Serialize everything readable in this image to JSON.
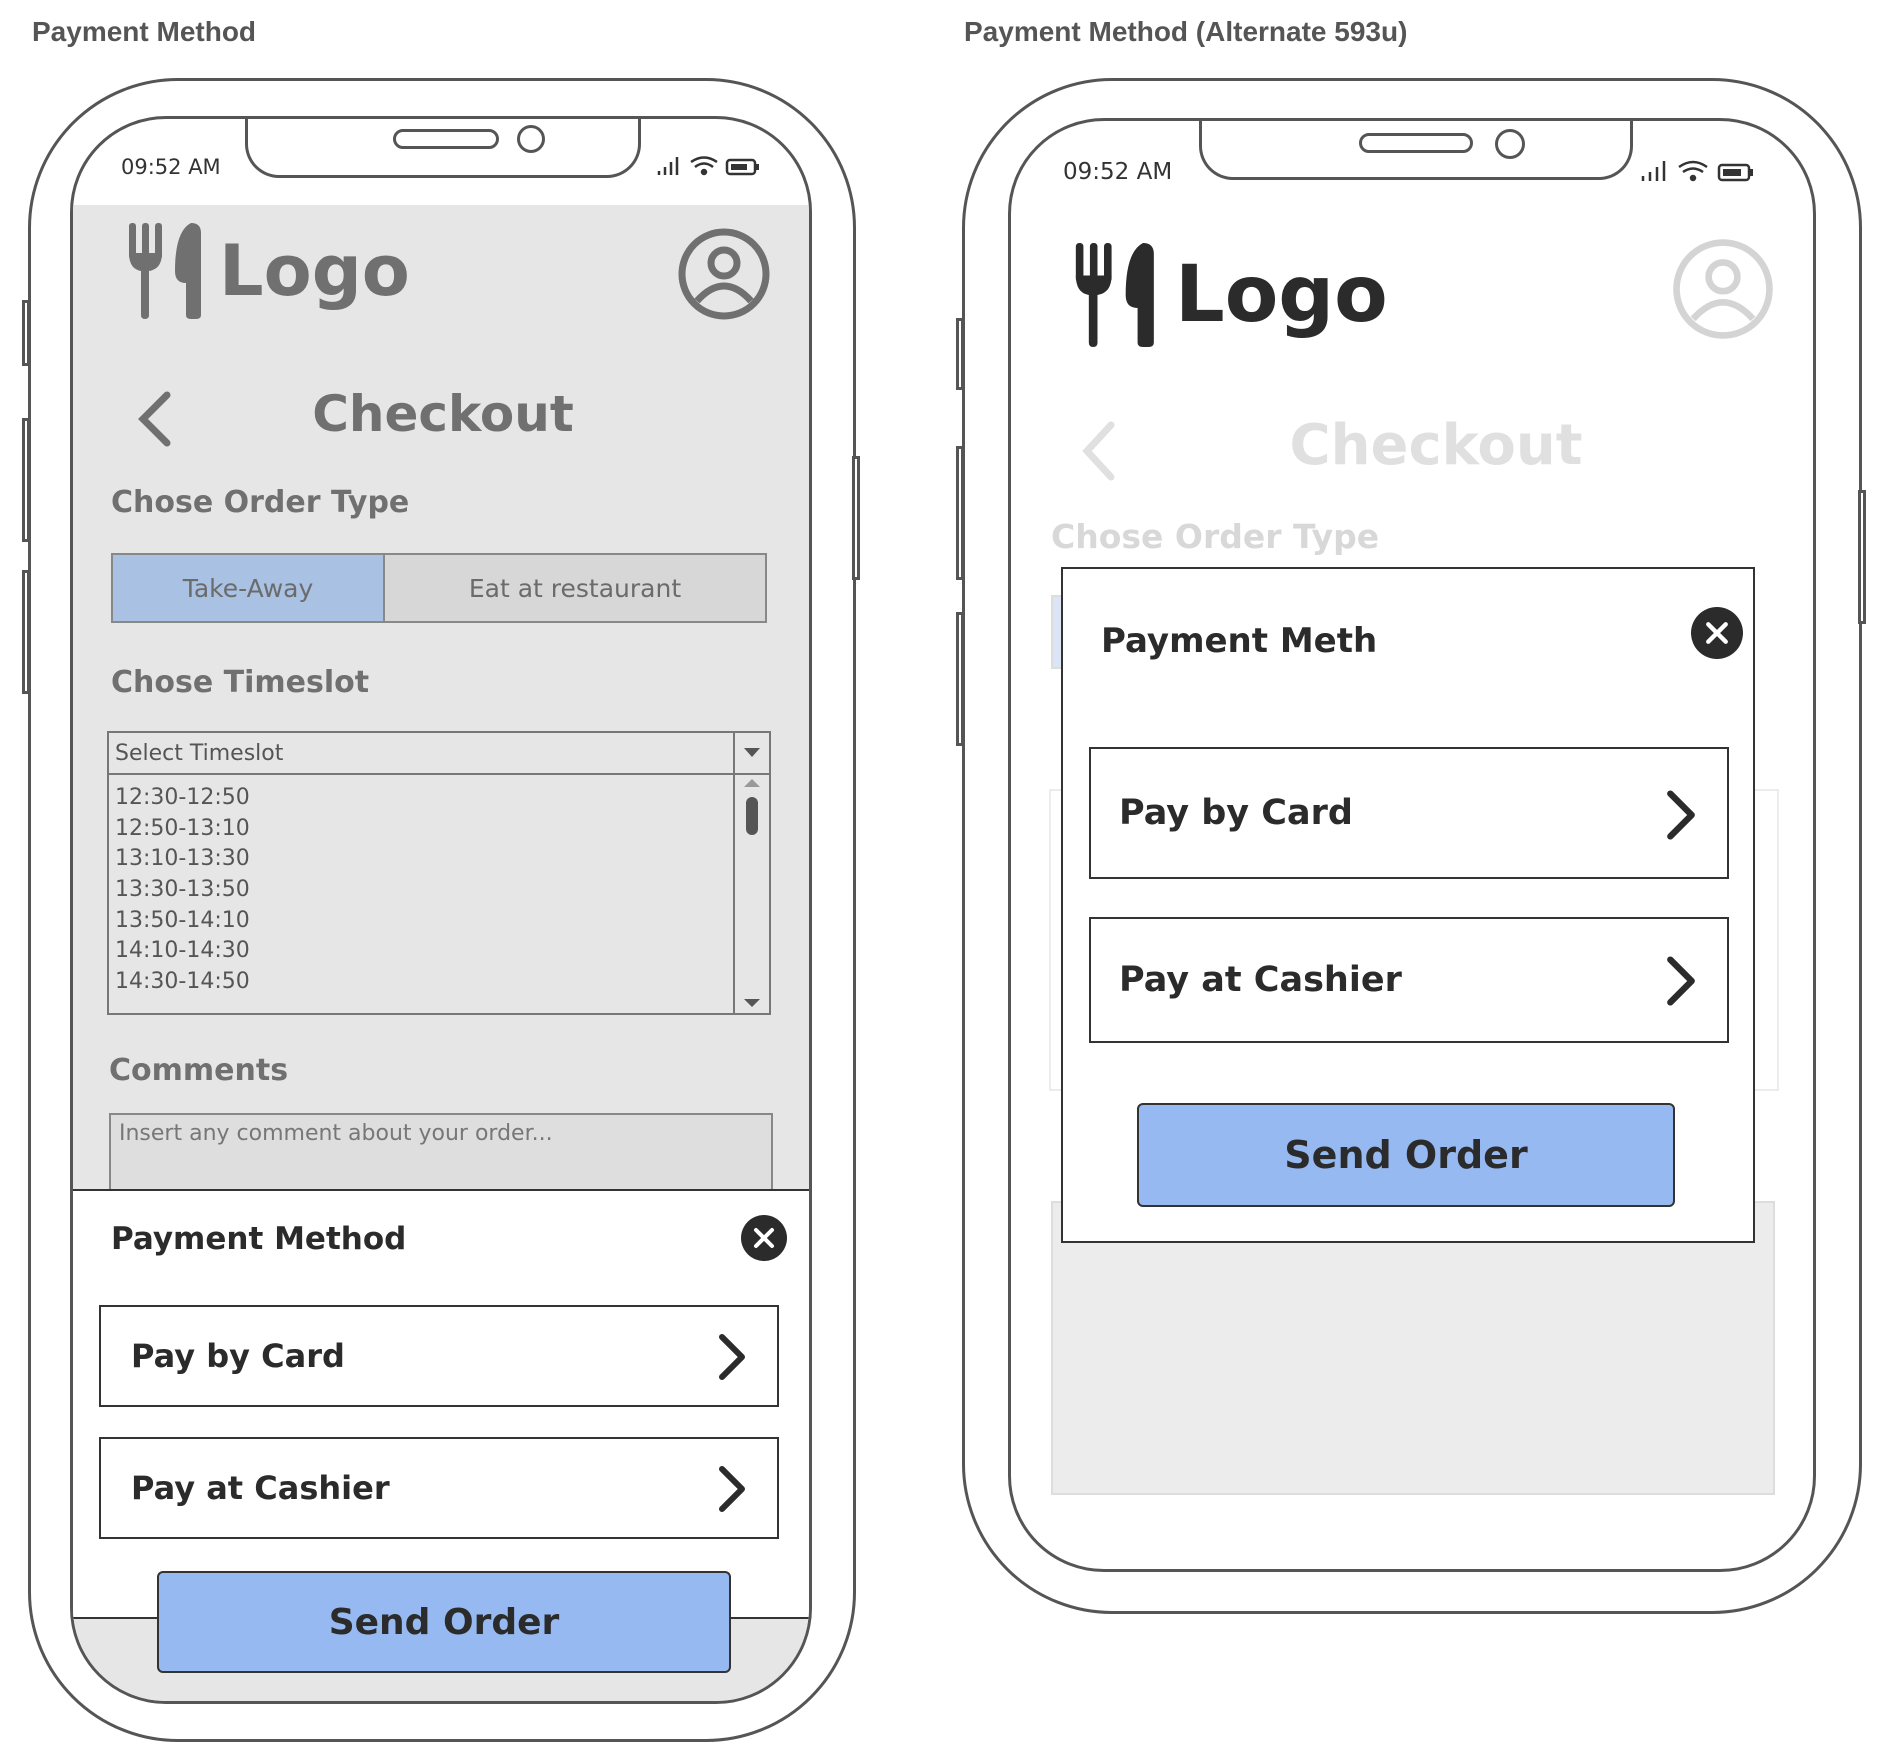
{
  "frames": [
    {
      "title": "Payment Method",
      "status_time": "09:52 AM",
      "logo_text": "Logo",
      "page_title": "Checkout",
      "order_type_label": "Chose Order Type",
      "order_types": [
        "Take-Away",
        "Eat at restaurant"
      ],
      "selected_order_type": "Take-Away",
      "timeslot_label": "Chose Timeslot",
      "timeslot_select_placeholder": "Select Timeslot",
      "timeslots": [
        "12:30-12:50",
        "12:50-13:10",
        "13:10-13:30",
        "13:30-13:50",
        "13:50-14:10",
        "14:10-14:30",
        "14:30-14:50"
      ],
      "comments_label": "Comments",
      "comments_placeholder": "Insert any comment about your order...",
      "sheet_title": "Payment Method",
      "options": [
        "Pay by Card",
        "Pay at Cashier"
      ],
      "primary_button": "Send Order"
    },
    {
      "title": "Payment Method (Alternate 593u)",
      "status_time": "09:52 AM",
      "logo_text": "Logo",
      "page_title": "Checkout",
      "order_type_label": "Chose Order Type",
      "sheet_title": "Payment Meth",
      "options": [
        "Pay by Card",
        "Pay at Cashier"
      ],
      "primary_button": "Send Order"
    }
  ],
  "colors": {
    "selected_segment": "#a9c1e3",
    "primary_button": "#95b9f0",
    "overlay_gray": "#e6e6e6",
    "outline": "#555555"
  },
  "icons": [
    "fork-knife-icon",
    "user-avatar-icon",
    "back-chevron-icon",
    "close-icon",
    "chevron-right-icon",
    "signal-icon",
    "wifi-icon",
    "battery-icon",
    "dropdown-arrow-icon"
  ]
}
